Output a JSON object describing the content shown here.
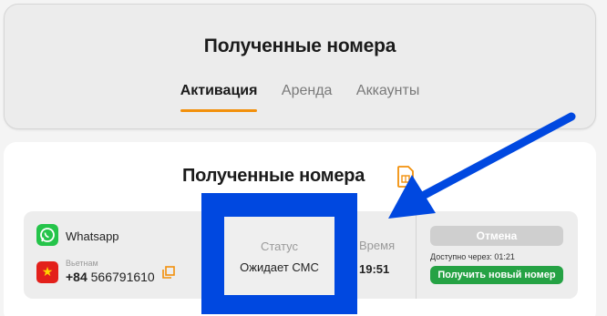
{
  "header": {
    "title": "Полученные номера",
    "tabs": [
      "Активация",
      "Аренда",
      "Аккаунты"
    ]
  },
  "main": {
    "title": "Полученные номера"
  },
  "row": {
    "service": "Whatsapp",
    "country": "Вьетнам",
    "phone_prefix": "+84",
    "phone_number": "566791610",
    "status_label": "Статус",
    "status_value": "Ожидает СМС",
    "time_label": "Время",
    "time_value": "19:51",
    "cancel_label": "Отмена",
    "available_text": "Доступно через:  01:21",
    "new_number_label": "Получить новый номер"
  },
  "icons": {
    "sim": "sim-card-icon",
    "whatsapp": "whatsapp-icon",
    "flag": "vietnam-flag-icon",
    "copy": "copy-icon"
  },
  "colors": {
    "accent": "#f2900b",
    "highlight": "#0048e0",
    "whatsapp": "#25c44a",
    "new_button": "#25a244",
    "cancel_button": "#cfcfcf"
  }
}
